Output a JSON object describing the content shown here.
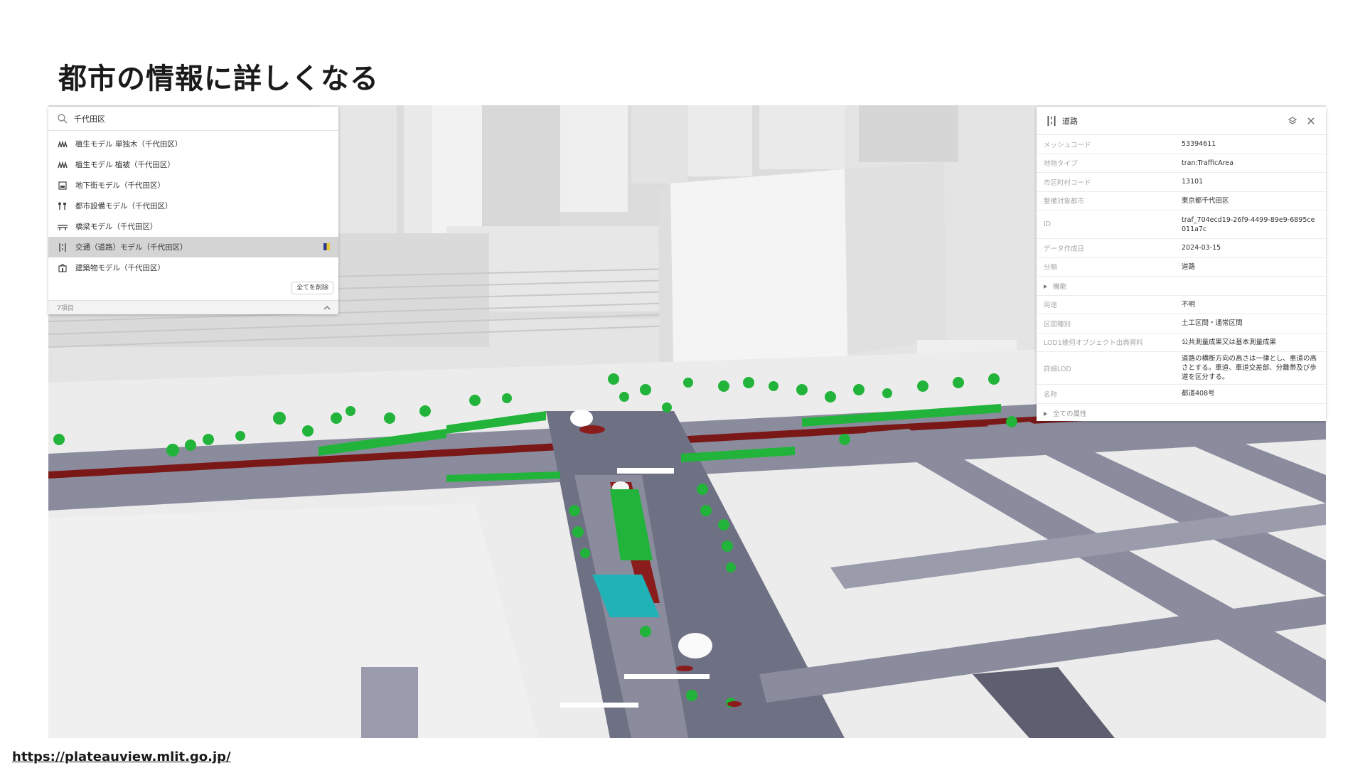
{
  "slide": {
    "title": "都市の情報に詳しくなる",
    "source_url": "https://plateauview.mlit.go.jp/"
  },
  "layer_panel": {
    "search_value": "千代田区",
    "items": [
      {
        "label": "植生モデル 単独木（千代田区）",
        "icon": "tree-icon",
        "selected": false
      },
      {
        "label": "植生モデル 植被（千代田区）",
        "icon": "tree-icon",
        "selected": false
      },
      {
        "label": "地下街モデル（千代田区）",
        "icon": "underground-icon",
        "selected": false
      },
      {
        "label": "都市設備モデル（千代田区）",
        "icon": "facility-icon",
        "selected": false
      },
      {
        "label": "橋梁モデル（千代田区）",
        "icon": "bridge-icon",
        "selected": false
      },
      {
        "label": "交通（道路）モデル（千代田区）",
        "icon": "road-icon",
        "selected": true
      },
      {
        "label": "建築物モデル（千代田区）",
        "icon": "building-icon",
        "selected": false
      }
    ],
    "remove_all_label": "全てを削除",
    "footer_label": "7項目"
  },
  "inspector": {
    "title": "道路",
    "properties": [
      {
        "key": "メッシュコード",
        "value": "53394611"
      },
      {
        "key": "地物タイプ",
        "value": "tran:TrafficArea"
      },
      {
        "key": "市区町村コード",
        "value": "13101"
      },
      {
        "key": "整備対象都市",
        "value": "東京都千代田区"
      },
      {
        "key": "ID",
        "value": "traf_704ecd19-26f9-4499-89e9-6895ce011a7c"
      },
      {
        "key": "データ作成日",
        "value": "2024-03-15"
      },
      {
        "key": "分類",
        "value": "道路"
      },
      {
        "key": "機能",
        "value": ""
      },
      {
        "key": "用途",
        "value": "不明"
      },
      {
        "key": "区間種別",
        "value": "土工区間・通常区間"
      },
      {
        "key": "LOD1幾何オブジェクト出典資料",
        "value": "公共測量成果又は基本測量成果"
      },
      {
        "key": "詳細LOD",
        "value": "道路の横断方向の高さは一律とし、車道の高さとする。車道、車道交差部、分離帯及び歩道を区分する。"
      },
      {
        "key": "名称",
        "value": "都道408号"
      },
      {
        "key": "全ての属性",
        "value": ""
      }
    ]
  },
  "colors": {
    "road": "#8a8c9e",
    "road_dark": "#5d5f70",
    "vegetation": "#22b43a",
    "median_red": "#8a1c1c",
    "crosswalk_cyan": "#1fb3b8",
    "building": "#ececec"
  }
}
